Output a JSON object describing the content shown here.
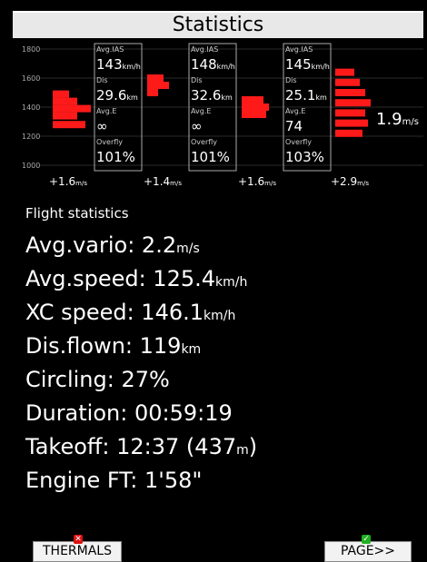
{
  "title": "Statistics",
  "chart_data": {
    "type": "bar",
    "y_axis_ticks": [
      "1800",
      "1600",
      "1400",
      "1200",
      "1000"
    ],
    "ylim": [
      1000,
      1800
    ],
    "right_label": "1.9",
    "right_label_unit": "m/s",
    "panels": [
      {
        "avg_ias_label": "Avg.IAS",
        "avg_ias": "143",
        "avg_ias_unit": "km/h",
        "dis_label": "Dis",
        "dis": "29.6",
        "dis_unit": "km",
        "avg_e_label": "Avg.E",
        "avg_e": "∞",
        "overfly_label": "Overfly",
        "overfly": "101%",
        "climb": "+1.6",
        "climb_unit": "m/s",
        "red_profile": [
          [
            1280,
            1.2
          ],
          [
            1340,
            0.9
          ],
          [
            1390,
            1.4
          ],
          [
            1440,
            0.9
          ],
          [
            1490,
            0.6
          ]
        ]
      },
      {
        "avg_ias_label": "Avg.IAS",
        "avg_ias": "148",
        "avg_ias_unit": "km/h",
        "dis_label": "Dis",
        "dis": "32.6",
        "dis_unit": "km",
        "avg_e_label": "Avg.E",
        "avg_e": "∞",
        "overfly_label": "Overfly",
        "overfly": "101%",
        "climb": "+1.4",
        "climb_unit": "m/s",
        "red_profile": [
          [
            1500,
            0.4
          ],
          [
            1550,
            0.8
          ],
          [
            1600,
            0.6
          ]
        ]
      },
      {
        "avg_ias_label": "Avg.IAS",
        "avg_ias": "145",
        "avg_ias_unit": "km/h",
        "dis_label": "Dis",
        "dis": "25.1",
        "dis_unit": "km",
        "avg_e_label": "Avg.E",
        "avg_e": "74",
        "overfly_label": "Overfly",
        "overfly": "103%",
        "climb": "+1.6",
        "climb_unit": "m/s",
        "red_profile": [
          [
            1350,
            0.9
          ],
          [
            1400,
            1.0
          ],
          [
            1450,
            0.8
          ]
        ]
      },
      {
        "climb": "+2.9",
        "climb_unit": "m/s",
        "red_profile": [
          [
            1220,
            1.0
          ],
          [
            1290,
            1.2
          ],
          [
            1360,
            1.1
          ],
          [
            1430,
            1.3
          ],
          [
            1500,
            1.1
          ],
          [
            1570,
            0.9
          ],
          [
            1640,
            0.7
          ]
        ]
      }
    ]
  },
  "flight_statistics_heading": "Flight statistics",
  "stats": [
    {
      "label": "Avg.vario: 2.2",
      "unit": "m/s"
    },
    {
      "label": "Avg.speed: 125.4",
      "unit": "km/h"
    },
    {
      "label": "XC speed: 146.1",
      "unit": "km/h"
    },
    {
      "label": "Dis.flown: 119",
      "unit": "km"
    },
    {
      "label": "Circling: 27%",
      "unit": ""
    },
    {
      "label": "Duration: 00:59:19",
      "unit": ""
    },
    {
      "label": "Takeoff: 12:37 (437",
      "unit": "m",
      "suffix": ")"
    },
    {
      "label": "Engine FT:  1'58\"",
      "unit": ""
    }
  ],
  "buttons": {
    "thermals": "THERMALS",
    "page": "PAGE>>"
  },
  "colors": {
    "bar": "#ff1a1a",
    "title_bg": "#e8e8e8",
    "badge_red": "#e01010",
    "badge_green": "#20b020"
  }
}
